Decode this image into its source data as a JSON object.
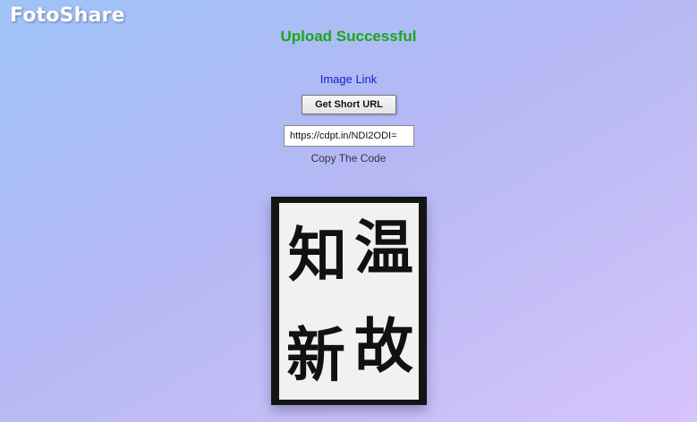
{
  "app": {
    "logo": "FotoShare"
  },
  "main": {
    "title": "Upload Successful",
    "image_link_label": "Image Link",
    "short_url_button": "Get Short URL",
    "url_value": "https://cdpt.in/NDI2ODI=",
    "copy_label": "Copy The Code"
  },
  "image": {
    "characters": [
      "温",
      "知",
      "故",
      "新"
    ]
  },
  "colors": {
    "title": "#1aa61a",
    "link": "#1a1ad0",
    "logo": "#ffffff"
  }
}
